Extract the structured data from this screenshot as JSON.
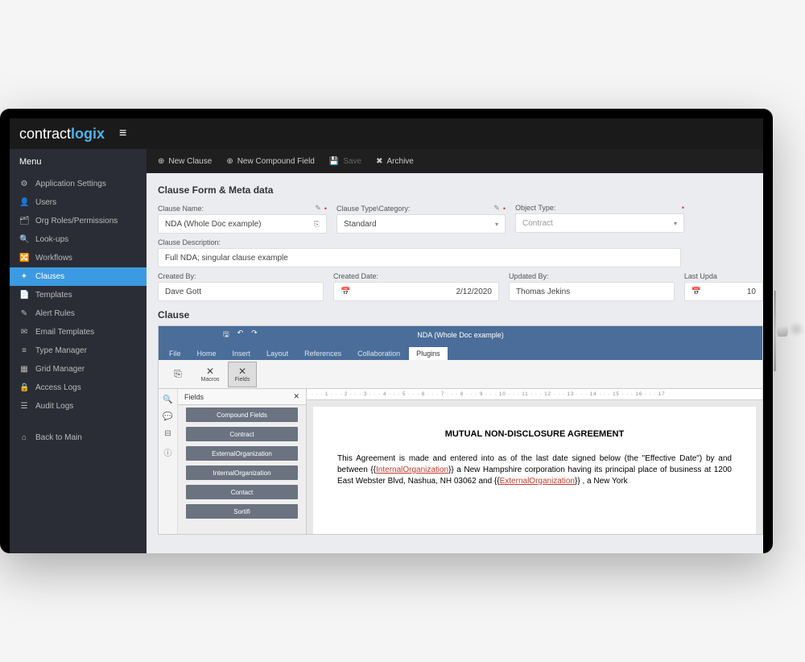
{
  "brand": {
    "part1": "contract",
    "part2": "logix"
  },
  "sidebar": {
    "title": "Menu",
    "items": [
      {
        "icon": "⚙",
        "label": "Application Settings"
      },
      {
        "icon": "👤",
        "label": "Users"
      },
      {
        "icon": "🗂",
        "label": "Org Roles/Permissions"
      },
      {
        "icon": "🔍",
        "label": "Look-ups"
      },
      {
        "icon": "🔀",
        "label": "Workflows"
      },
      {
        "icon": "✦",
        "label": "Clauses"
      },
      {
        "icon": "📄",
        "label": "Templates"
      },
      {
        "icon": "✎",
        "label": "Alert Rules"
      },
      {
        "icon": "✉",
        "label": "Email Templates"
      },
      {
        "icon": "≡",
        "label": "Type Manager"
      },
      {
        "icon": "▦",
        "label": "Grid Manager"
      },
      {
        "icon": "🔒",
        "label": "Access Logs"
      },
      {
        "icon": "☰",
        "label": "Audit Logs"
      }
    ],
    "back": {
      "icon": "⌂",
      "label": "Back to Main"
    }
  },
  "toolbar": {
    "new_clause": "New Clause",
    "new_compound": "New Compound Field",
    "save": "Save",
    "archive": "Archive"
  },
  "section": {
    "meta_title": "Clause Form & Meta data",
    "clause_title": "Clause"
  },
  "form": {
    "name": {
      "label": "Clause Name:",
      "value": "NDA (Whole Doc example)"
    },
    "type": {
      "label": "Clause Type\\Category:",
      "value": "Standard"
    },
    "obj": {
      "label": "Object Type:",
      "value": "Contract"
    },
    "desc": {
      "label": "Clause Description:",
      "value": "Full NDA; singular clause example"
    },
    "created_by": {
      "label": "Created By:",
      "value": "Dave Gott"
    },
    "created_date": {
      "label": "Created Date:",
      "value": "2/12/2020"
    },
    "updated_by": {
      "label": "Updated By:",
      "value": "Thomas Jekins"
    },
    "last_updated": {
      "label": "Last Upda",
      "value": "10"
    }
  },
  "editor": {
    "doc_title": "NDA (Whole Doc example)",
    "tabs": [
      "File",
      "Home",
      "Insert",
      "Layout",
      "References",
      "Collaboration",
      "Plugins"
    ],
    "ribbon": {
      "macros": "Macros",
      "fields": "Fields"
    },
    "fields_panel": {
      "title": "Fields",
      "items": [
        "Compound Fields",
        "Contract",
        "ExternalOrganization",
        "InternalOrganization",
        "Contact",
        "Sortifi"
      ]
    },
    "ruler": "· · · 1 · · · 2 · · · 3 · · · 4 · · · 5 · · · 6 · · · 7 · · · 8 · · · 9 · · · 10 · · · 11 · · · 12 · · · 13 · · · 14 · · · 15 · · · 16 · · · 17"
  },
  "document": {
    "heading": "MUTUAL NON-DISCLOSURE AGREEMENT",
    "p1a": "This Agreement is made and entered into as of the last date signed below (the \"Effective Date\") by and between {{",
    "m1": "InternalOrganization",
    "p1b": "}} a New Hampshire corporation having its principal place of business at 1200 East Webster Blvd, Nashua, NH 03062 and {{",
    "m2": "ExternalOrganization",
    "p1c": "}} , a New York"
  }
}
